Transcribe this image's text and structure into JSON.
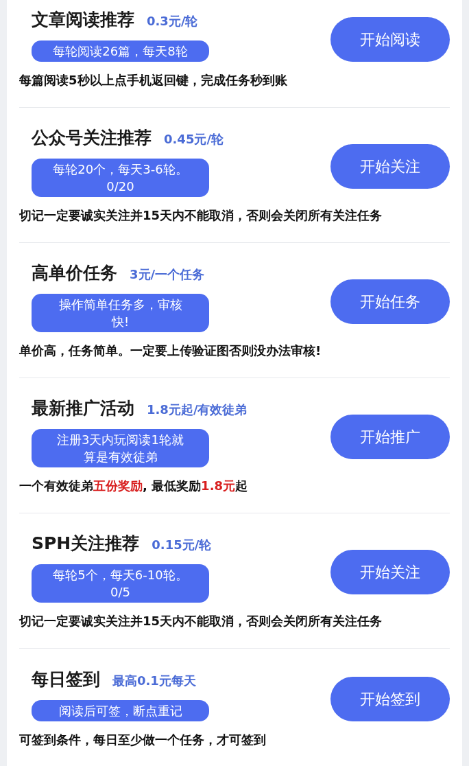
{
  "tasks": [
    {
      "title": "文章阅读推荐",
      "price": "0.3元/轮",
      "tag_lines": [
        "每轮阅读26篇，每天8轮"
      ],
      "button": "开始阅读",
      "note": [
        {
          "text": "每篇阅读5秒以上点手机返回键，完成任务秒到账",
          "highlight": false
        }
      ]
    },
    {
      "title": "公众号关注推荐",
      "price": "0.45元/轮",
      "tag_lines": [
        "每轮20个，每天3-6轮。",
        "0/20"
      ],
      "button": "开始关注",
      "note": [
        {
          "text": "切记一定要诚实关注并15天内不能取消，否则会关闭所有关注任务",
          "highlight": false
        }
      ]
    },
    {
      "title": "高单价任务",
      "price": "3元/一个任务",
      "tag_lines": [
        "操作简单任务多，审核",
        "快!"
      ],
      "button": "开始任务",
      "note": [
        {
          "text": "单价高，任务简单。一定要上传验证图否则没办法审核!",
          "highlight": false
        }
      ]
    },
    {
      "title": "最新推广活动",
      "price": "1.8元起/有效徒弟",
      "tag_lines": [
        "注册3天内玩阅读1轮就",
        "算是有效徒弟"
      ],
      "button": "开始推广",
      "note": [
        {
          "text": "一个有效徒弟",
          "highlight": false
        },
        {
          "text": "五份奖励",
          "highlight": true
        },
        {
          "text": ", 最低奖励",
          "highlight": false
        },
        {
          "text": "1.8元",
          "highlight": true
        },
        {
          "text": "起",
          "highlight": false
        }
      ]
    },
    {
      "title": "SPH关注推荐",
      "price": "0.15元/轮",
      "tag_lines": [
        "每轮5个，每天6-10轮。",
        "0/5"
      ],
      "button": "开始关注",
      "note": [
        {
          "text": "切记一定要诚实关注并15天内不能取消，否则会关闭所有关注任务",
          "highlight": false
        }
      ]
    },
    {
      "title": "每日签到",
      "price": "最高0.1元每天",
      "tag_lines": [
        "阅读后可签，断点重记"
      ],
      "button": "开始签到",
      "note": [
        {
          "text": "可签到条件，每日至少做一个任务，才可签到",
          "highlight": false
        }
      ]
    }
  ]
}
